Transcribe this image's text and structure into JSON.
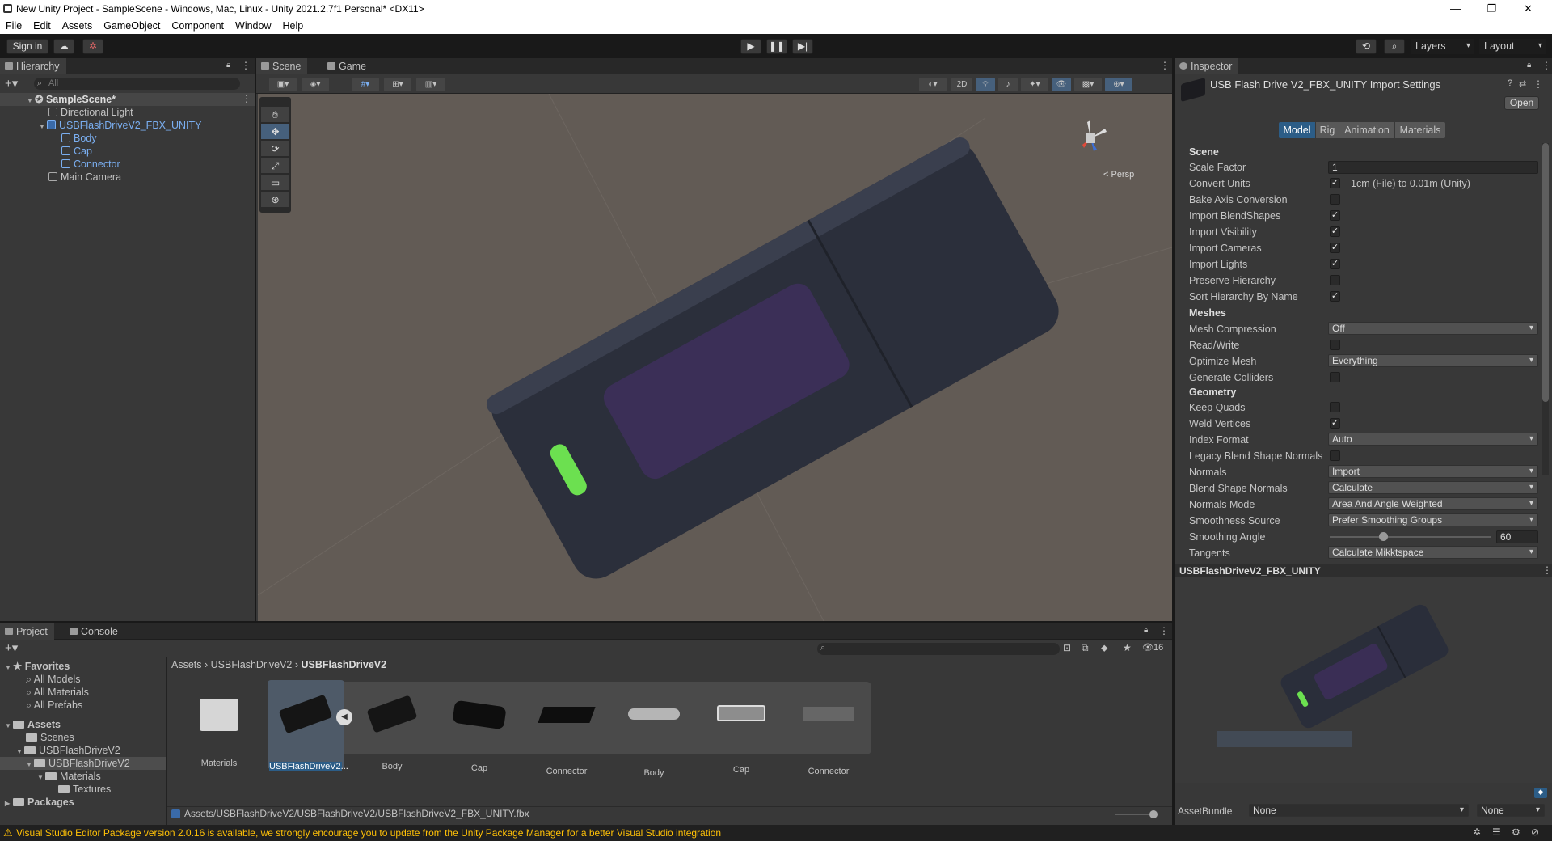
{
  "window": {
    "title": "New Unity Project - SampleScene - Windows, Mac, Linux - Unity 2021.2.7f1 Personal* <DX11>",
    "minimize": "—",
    "maximize": "❐",
    "close": "✕"
  },
  "menu": [
    "File",
    "Edit",
    "Assets",
    "GameObject",
    "Component",
    "Window",
    "Help"
  ],
  "toolbar": {
    "sign_in": "Sign in",
    "layers": "Layers",
    "layout": "Layout"
  },
  "hierarchy": {
    "tab": "Hierarchy",
    "search_placeholder": "All",
    "scene": "SampleScene*",
    "items": [
      "Directional Light",
      "USBFlashDriveV2_FBX_UNITY",
      "Body",
      "Cap",
      "Connector",
      "Main Camera"
    ]
  },
  "scene": {
    "tabs": [
      "Scene",
      "Game"
    ],
    "mode_2d": "2D",
    "persp": "< Persp"
  },
  "inspector": {
    "tab": "Inspector",
    "title": "USB Flash Drive V2_FBX_UNITY Import Settings",
    "open": "Open",
    "tabs": [
      "Model",
      "Rig",
      "Animation",
      "Materials"
    ],
    "sections": {
      "scene": "Scene",
      "meshes": "Meshes",
      "geometry": "Geometry"
    },
    "labels": {
      "scale_factor": "Scale Factor",
      "convert_units": "Convert Units",
      "bake_axis": "Bake Axis Conversion",
      "import_blendshapes": "Import BlendShapes",
      "import_visibility": "Import Visibility",
      "import_cameras": "Import Cameras",
      "import_lights": "Import Lights",
      "preserve_hierarchy": "Preserve Hierarchy",
      "sort_hierarchy": "Sort Hierarchy By Name",
      "mesh_compression": "Mesh Compression",
      "read_write": "Read/Write",
      "optimize_mesh": "Optimize Mesh",
      "generate_colliders": "Generate Colliders",
      "keep_quads": "Keep Quads",
      "weld_vertices": "Weld Vertices",
      "index_format": "Index Format",
      "legacy_blend": "Legacy Blend Shape Normals",
      "normals": "Normals",
      "blend_shape_normals": "Blend Shape Normals",
      "normals_mode": "Normals Mode",
      "smoothness_source": "Smoothness Source",
      "smoothing_angle": "Smoothing Angle",
      "tangents": "Tangents"
    },
    "values": {
      "scale_factor": "1",
      "convert_units_text": "1cm (File) to 0.01m (Unity)",
      "mesh_compression": "Off",
      "optimize_mesh": "Everything",
      "index_format": "Auto",
      "normals": "Import",
      "blend_shape_normals": "Calculate",
      "normals_mode": "Area And Angle Weighted",
      "smoothness_source": "Prefer Smoothing Groups",
      "smoothing_angle": "60",
      "smoothing_angle_fraction": 0.33,
      "tangents": "Calculate Mikktspace"
    },
    "checks": {
      "convert_units": true,
      "bake_axis": false,
      "import_blendshapes": true,
      "import_visibility": true,
      "import_cameras": true,
      "import_lights": true,
      "preserve_hierarchy": false,
      "sort_hierarchy": true,
      "read_write": false,
      "generate_colliders": false,
      "keep_quads": false,
      "weld_vertices": true,
      "legacy_blend": false
    },
    "preview_title": "USBFlashDriveV2_FBX_UNITY",
    "asset_bundle": "AssetBundle",
    "asset_bundle_value": "None",
    "asset_bundle_variant": "None"
  },
  "project": {
    "tabs": [
      "Project",
      "Console"
    ],
    "favorites": "Favorites",
    "fav_items": [
      "All Models",
      "All Materials",
      "All Prefabs"
    ],
    "assets": "Assets",
    "tree": [
      "Scenes",
      "USBFlashDriveV2",
      "USBFlashDriveV2",
      "Materials",
      "Textures"
    ],
    "packages": "Packages",
    "breadcrumb": [
      "Assets",
      "USBFlashDriveV2",
      "USBFlashDriveV2"
    ],
    "hidden_count": "16",
    "items": [
      "Materials",
      "USBFlashDriveV2...",
      "Body",
      "Cap",
      "Connector",
      "Body",
      "Cap",
      "Connector"
    ],
    "path": "Assets/USBFlashDriveV2/USBFlashDriveV2/USBFlashDriveV2_FBX_UNITY.fbx"
  },
  "status": {
    "message": "Visual Studio Editor Package version 2.0.16 is available, we strongly encourage you to update from the Unity Package Manager for a better Visual Studio integration"
  },
  "colors": {
    "accent": "#2c5d87",
    "scene_bg": "#625b55",
    "warning": "#ffc107",
    "selection_blue": "#7aaef0"
  }
}
